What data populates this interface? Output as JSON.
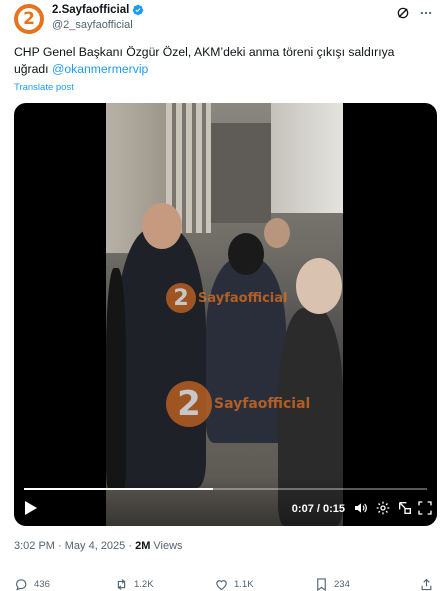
{
  "author": {
    "display_name": "2.Sayfaofficial",
    "handle": "@2_sayfaofficial",
    "avatar_text": "2"
  },
  "tweet": {
    "text": "CHP Genel Başkanı Özgür Özel, AKM’deki anma töreni çıkışı saldırıya uğradı ",
    "mention": "@okanmermervip",
    "translate_label": "Translate post"
  },
  "video": {
    "watermark_number": "2",
    "watermark_text": "Sayfaofficial",
    "time_label": "0:07 / 0:15",
    "progress_fraction": 0.47
  },
  "meta": {
    "time": "3:02 PM",
    "separator": " · ",
    "date": "May 4, 2025",
    "views_count": "2M",
    "views_label": " Views"
  },
  "actions": {
    "replies": "436",
    "reposts": "1.2K",
    "likes": "1.1K",
    "bookmarks": "234"
  },
  "colors": {
    "accent": "#1d9bf0",
    "brand_orange": "#e8731f",
    "secondary_text": "#536471"
  }
}
